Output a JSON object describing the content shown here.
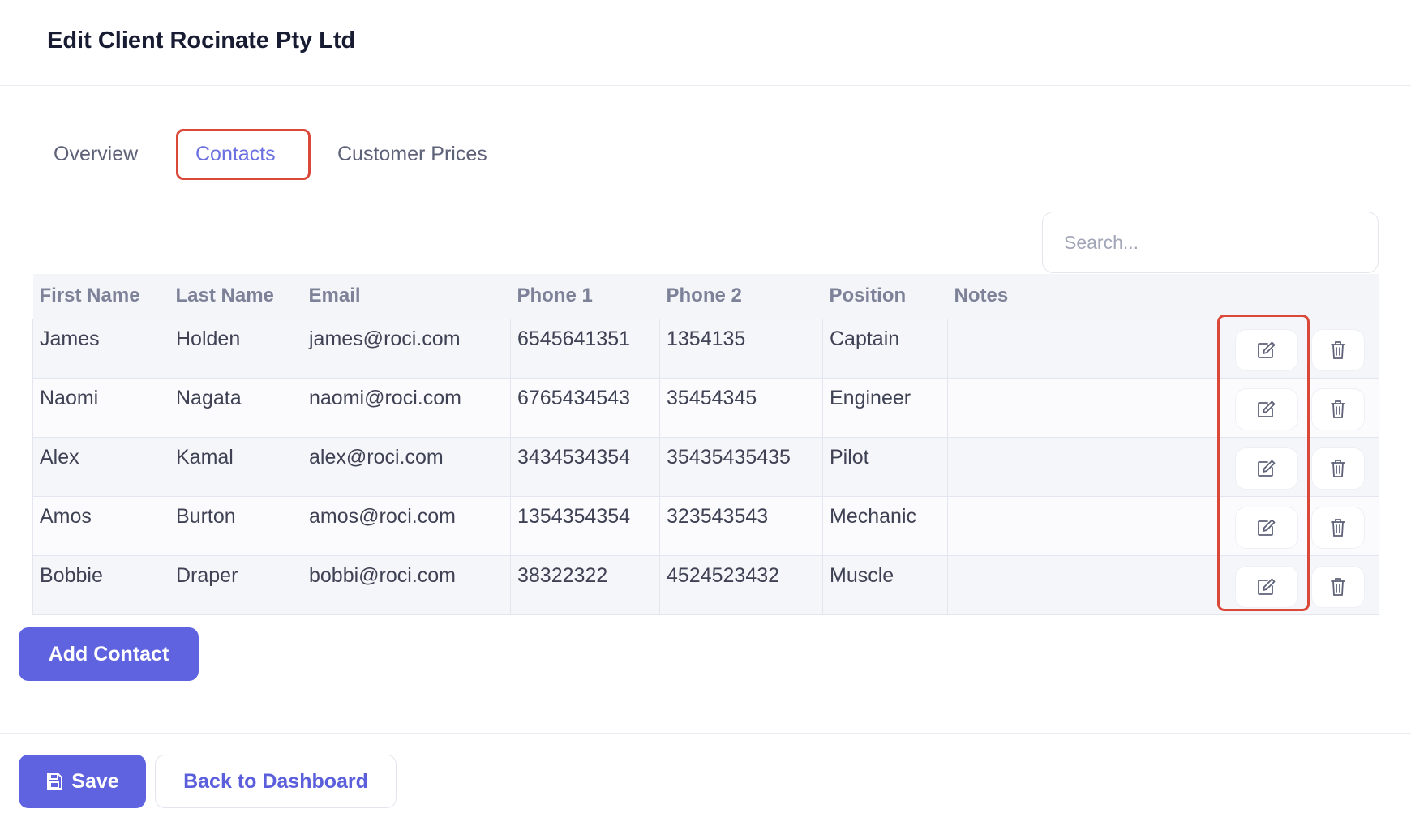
{
  "page": {
    "title": "Edit Client Rocinate Pty Ltd"
  },
  "tabs": [
    {
      "label": "Overview",
      "active": false
    },
    {
      "label": "Contacts",
      "active": true
    },
    {
      "label": "Customer Prices",
      "active": false
    }
  ],
  "search": {
    "placeholder": "Search..."
  },
  "table": {
    "headers": [
      "First Name",
      "Last Name",
      "Email",
      "Phone 1",
      "Phone 2",
      "Position",
      "Notes"
    ],
    "rows": [
      {
        "first": "James",
        "last": "Holden",
        "email": "james@roci.com",
        "phone1": "6545641351",
        "phone2": "1354135",
        "position": "Captain",
        "notes": ""
      },
      {
        "first": "Naomi",
        "last": "Nagata",
        "email": "naomi@roci.com",
        "phone1": "6765434543",
        "phone2": "35454345",
        "position": "Engineer",
        "notes": ""
      },
      {
        "first": "Alex",
        "last": "Kamal",
        "email": "alex@roci.com",
        "phone1": "3434534354",
        "phone2": "35435435435",
        "position": "Pilot",
        "notes": ""
      },
      {
        "first": "Amos",
        "last": "Burton",
        "email": "amos@roci.com",
        "phone1": "1354354354",
        "phone2": "323543543",
        "position": "Mechanic",
        "notes": ""
      },
      {
        "first": "Bobbie",
        "last": "Draper",
        "email": "bobbi@roci.com",
        "phone1": "38322322",
        "phone2": "4524523432",
        "position": "Muscle",
        "notes": ""
      }
    ]
  },
  "buttons": {
    "add_contact": "Add Contact",
    "save": "Save",
    "back": "Back to Dashboard"
  },
  "icons": {
    "edit": "edit-icon",
    "delete": "trash-icon",
    "save": "floppy-disk-icon"
  },
  "colors": {
    "primary": "#6063e0",
    "active_tab": "#6b70e0",
    "highlight": "#d94838"
  }
}
